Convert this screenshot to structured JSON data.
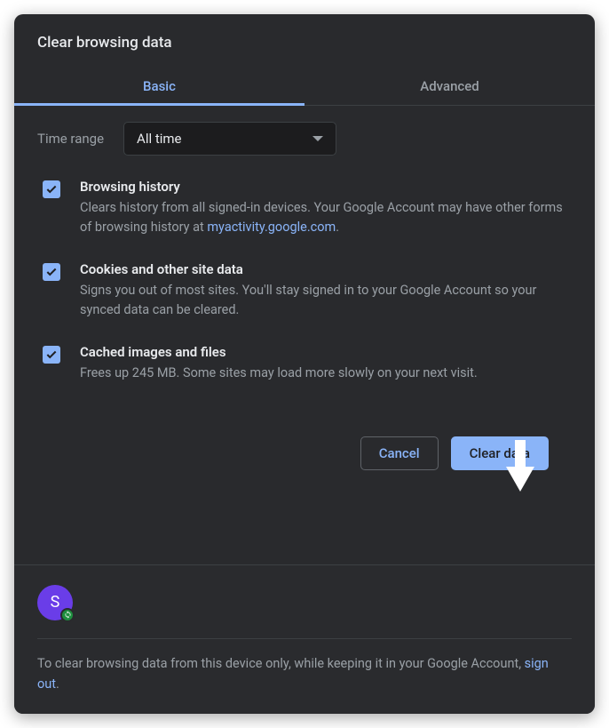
{
  "dialog": {
    "title": "Clear browsing data"
  },
  "tabs": {
    "basic": "Basic",
    "advanced": "Advanced"
  },
  "timerange": {
    "label": "Time range",
    "value": "All time"
  },
  "options": {
    "history": {
      "title": "Browsing history",
      "desc_before": "Clears history from all signed-in devices. Your Google Account may have other forms of browsing history at ",
      "link": "myactivity.google.com",
      "desc_after": "."
    },
    "cookies": {
      "title": "Cookies and other site data",
      "desc": "Signs you out of most sites. You'll stay signed in to your Google Account so your synced data can be cleared."
    },
    "cache": {
      "title": "Cached images and files",
      "desc": "Frees up 245 MB. Some sites may load more slowly on your next visit."
    }
  },
  "buttons": {
    "cancel": "Cancel",
    "clear": "Clear data"
  },
  "avatar": {
    "initial": "S"
  },
  "footer": {
    "text_before": "To clear browsing data from this device only, while keeping it in your Google Account, ",
    "link": "sign out",
    "text_after": "."
  }
}
